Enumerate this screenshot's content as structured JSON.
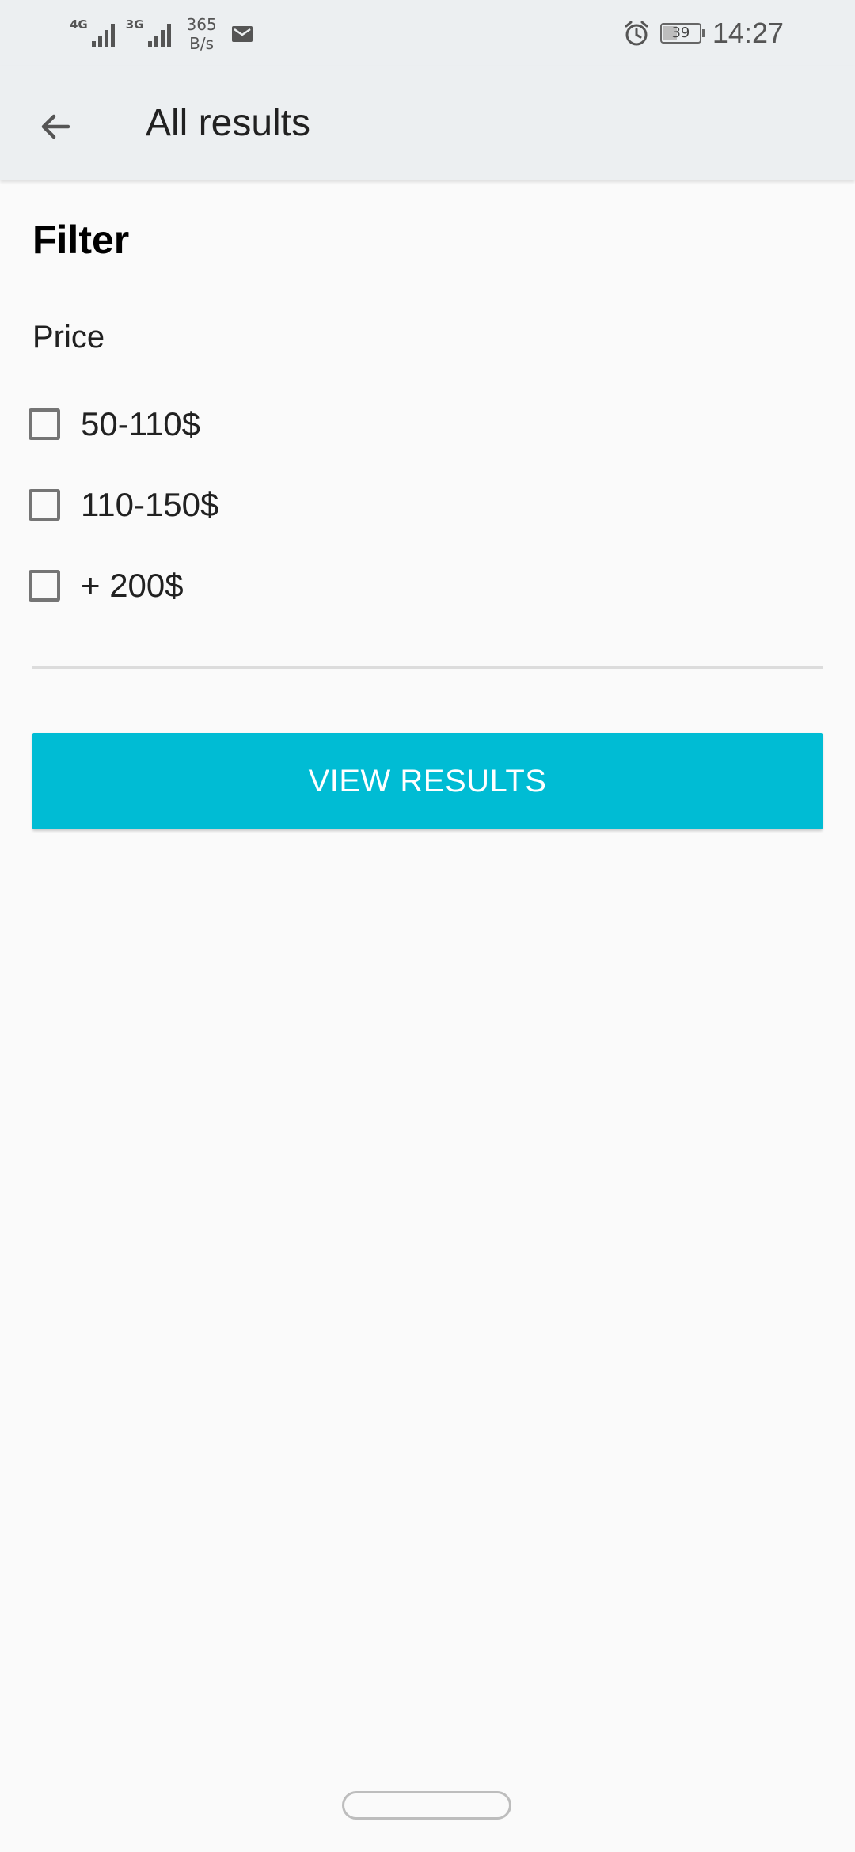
{
  "status_bar": {
    "network_1": "4G",
    "network_2": "3G",
    "net_speed_value": "365",
    "net_speed_unit": "B/s",
    "battery_level": "39",
    "time": "14:27",
    "icons": [
      "signal-4g-icon",
      "signal-3g-icon",
      "mail-icon",
      "alarm-icon",
      "battery-icon"
    ]
  },
  "app_bar": {
    "back_icon": "arrow-back-icon",
    "title": "All results"
  },
  "filter": {
    "heading": "Filter",
    "section_label": "Price",
    "options": [
      {
        "label": "50-110$",
        "checked": false
      },
      {
        "label": "110-150$",
        "checked": false
      },
      {
        "label": "+ 200$",
        "checked": false
      }
    ],
    "button_label": "VIEW RESULTS"
  },
  "colors": {
    "status_bar_bg": "#eceff1",
    "app_bar_bg": "#eceff1",
    "page_bg": "#fafafa",
    "accent": "#00bcd4",
    "checkbox_border": "#757575"
  }
}
